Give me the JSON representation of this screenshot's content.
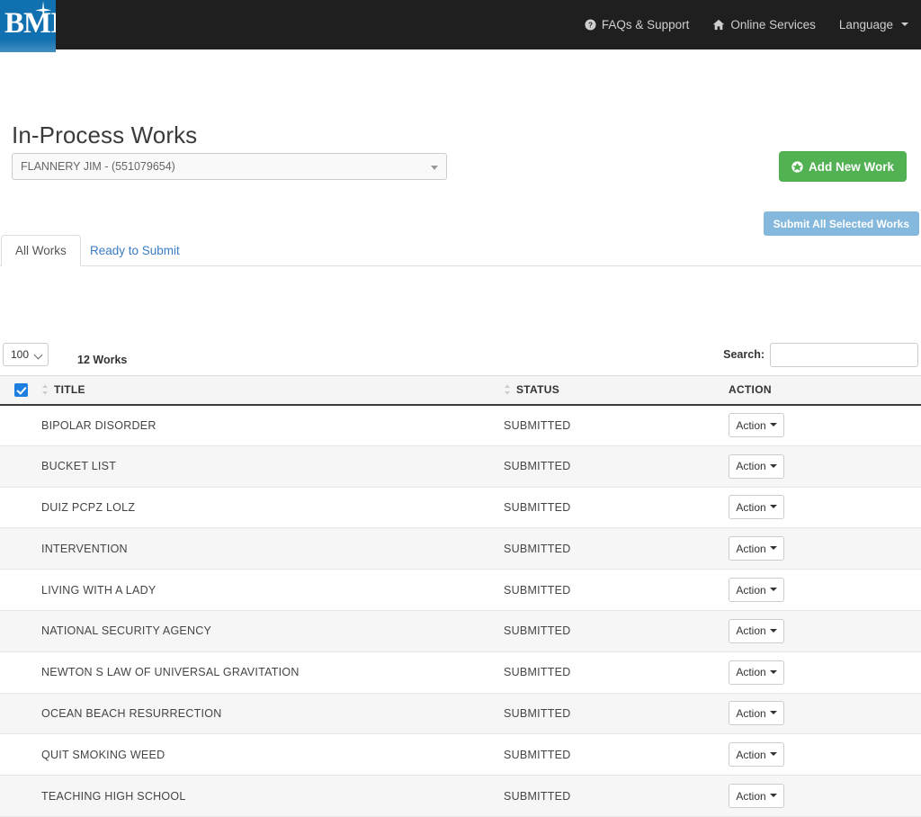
{
  "brand": {
    "logo_text": "BMI",
    "logo_bg": "#1070b0"
  },
  "topnav": {
    "items": [
      {
        "label": "FAQs & Support",
        "icon": "question-circle-icon"
      },
      {
        "label": "Online Services",
        "icon": "home-icon"
      },
      {
        "label": "Language",
        "icon": "chevron-down-icon"
      }
    ]
  },
  "page": {
    "title": "In-Process Works"
  },
  "writer_select": {
    "value": "FLANNERY JIM - (551079654)"
  },
  "buttons": {
    "add_new_work": "Add New Work",
    "submit_all": "Submit All Selected Works",
    "add_color": "#52b152",
    "submit_color": "#85b8dd"
  },
  "tabs": [
    {
      "label": "All Works",
      "active": true
    },
    {
      "label": "Ready to Submit",
      "active": false
    }
  ],
  "controls": {
    "page_length": "100",
    "works_count": "12 Works",
    "search_label": "Search:",
    "search_value": "",
    "search_placeholder": ""
  },
  "table": {
    "headers": {
      "title": "TITLE",
      "status": "STATUS",
      "action": "ACTION"
    },
    "select_all_checked": true,
    "action_label": "Action",
    "rows": [
      {
        "title": "BIPOLAR DISORDER",
        "status": "SUBMITTED",
        "action": "Action"
      },
      {
        "title": "BUCKET LIST",
        "status": "SUBMITTED",
        "action": "Action"
      },
      {
        "title": "DUIZ PCPZ LOLZ",
        "status": "SUBMITTED",
        "action": "Action"
      },
      {
        "title": "INTERVENTION",
        "status": "SUBMITTED",
        "action": "Action"
      },
      {
        "title": "LIVING WITH A LADY",
        "status": "SUBMITTED",
        "action": "Action"
      },
      {
        "title": "NATIONAL SECURITY AGENCY",
        "status": "SUBMITTED",
        "action": "Action"
      },
      {
        "title": "NEWTON S LAW OF UNIVERSAL GRAVITATION",
        "status": "SUBMITTED",
        "action": "Action"
      },
      {
        "title": "OCEAN BEACH RESURRECTION",
        "status": "SUBMITTED",
        "action": "Action"
      },
      {
        "title": "QUIT SMOKING WEED",
        "status": "SUBMITTED",
        "action": "Action"
      },
      {
        "title": "TEACHING HIGH SCHOOL",
        "status": "SUBMITTED",
        "action": "Action"
      }
    ]
  }
}
